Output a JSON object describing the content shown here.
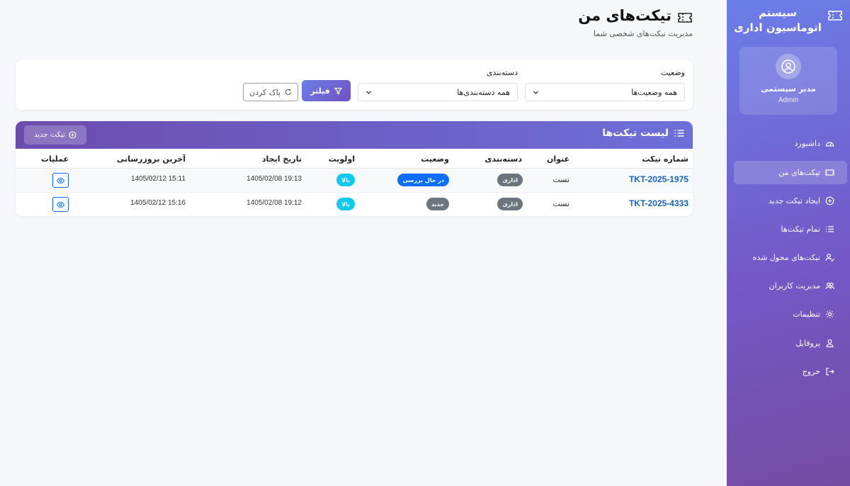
{
  "sidebar": {
    "brand": "سیستم اتوماسیون اداری",
    "brand_icon": "ticket-icon",
    "user": {
      "name": "مدیر سیستمی",
      "role": "Admin",
      "icon": "user-circle-icon"
    },
    "items": [
      {
        "label": "داشبورد",
        "icon": "speedometer-icon",
        "active": false
      },
      {
        "label": "تیکت‌های من",
        "icon": "ticket-icon",
        "active": true
      },
      {
        "label": "ایجاد تیکت جدید",
        "icon": "plus-circle-icon",
        "active": false
      },
      {
        "label": "تمام تیکت‌ها",
        "icon": "list-icon",
        "active": false
      },
      {
        "label": "تیکت‌های محول شده",
        "icon": "user-check-icon",
        "active": false
      },
      {
        "label": "مدیریت کاربران",
        "icon": "users-icon",
        "active": false
      },
      {
        "label": "تنظیمات",
        "icon": "gear-icon",
        "active": false
      },
      {
        "label": "پروفایل",
        "icon": "user-icon",
        "active": false
      },
      {
        "label": "خروج",
        "icon": "logout-icon",
        "active": false
      }
    ]
  },
  "header": {
    "title": "تیکت‌های من",
    "subtitle": "مدیریت تیکت‌های شخصی شما",
    "icon": "ticket-icon"
  },
  "filters": {
    "status_label": "وضعیت",
    "status_value": "همه وضعیت‌ها",
    "category_label": "دسته‌بندی",
    "category_value": "همه دسته‌بندی‌ها",
    "filter_button": "فیلتر",
    "clear_button": "پاک کردن"
  },
  "tickets": {
    "title": "لیست تیکت‌ها",
    "new_button": "تیکت جدید",
    "columns": {
      "number": "شماره تیکت",
      "subject": "عنوان",
      "category": "دسته‌بندی",
      "status": "وضعیت",
      "priority": "اولویت",
      "created": "تاریخ ایجاد",
      "updated": "آخرین بروزرسانی",
      "actions": "عملیات"
    },
    "rows": [
      {
        "number": "TKT-2025-1975",
        "subject": "تست",
        "category": "اداری",
        "status": "در حال بررسی",
        "status_color": "#0d6efd",
        "priority": "بالا",
        "created": "1405/02/08 19:13",
        "updated": "1405/02/12 15:11"
      },
      {
        "number": "TKT-2025-4333",
        "subject": "تست",
        "category": "اداری",
        "status": "جدید",
        "status_color": "#6c757d",
        "priority": "بالا",
        "created": "1405/02/08 19:12",
        "updated": "1405/02/12 15:16"
      }
    ]
  },
  "colors": {
    "accent": "#6a7ee8",
    "accent_dark": "#764ba2",
    "link": "#1565c0",
    "badge_cyan": "#0dcaf0",
    "badge_gray": "#6c757d"
  }
}
